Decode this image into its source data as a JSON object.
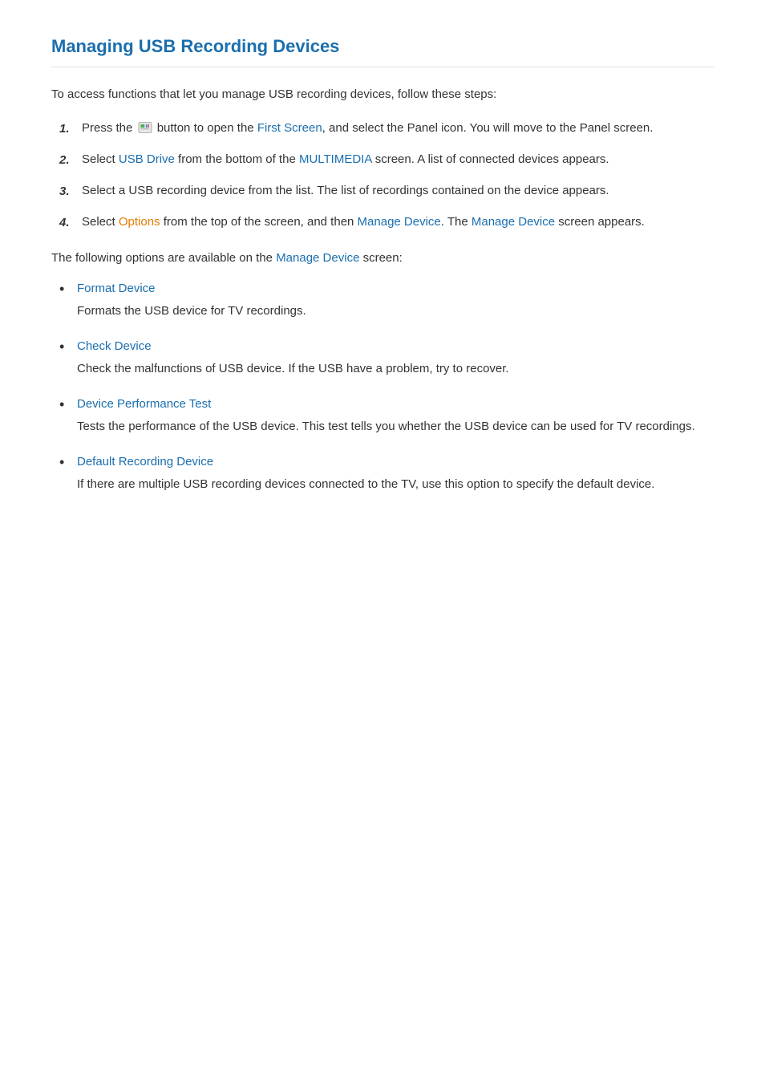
{
  "page": {
    "title": "Managing USB Recording Devices",
    "intro": "To access functions that let you manage USB recording devices, follow these steps:",
    "steps": [
      {
        "number": "1.",
        "text_before": "Press the",
        "icon": "usb-icon",
        "text_after": "button to open the",
        "link1": "First Screen",
        "text_middle": ", and select the Panel icon. You will move to the Panel screen."
      },
      {
        "number": "2.",
        "text_before": "Select",
        "link1": "USB Drive",
        "text_middle": "from the bottom of the",
        "link2": "MULTIMEDIA",
        "text_after": "screen. A list of connected devices appears."
      },
      {
        "number": "3.",
        "text": "Select a USB recording device from the list. The list of recordings contained on the device appears."
      },
      {
        "number": "4.",
        "text_before": "Select",
        "link1": "Options",
        "text_middle": "from the top of the screen, and then",
        "link2": "Manage Device",
        "text_after": ". The",
        "link3": "Manage Device",
        "text_end": "screen appears."
      }
    ],
    "options_intro_before": "The following options are available on the",
    "options_intro_link": "Manage Device",
    "options_intro_after": "screen:",
    "options": [
      {
        "title": "Format Device",
        "description": "Formats the USB device for TV recordings."
      },
      {
        "title": "Check Device",
        "description": "Check the malfunctions of USB device. If the USB have a problem, try to recover."
      },
      {
        "title": "Device Performance Test",
        "description": "Tests the performance of the USB device. This test tells you whether the USB device can be used for TV recordings."
      },
      {
        "title": "Default Recording Device",
        "description": "If there are multiple USB recording devices connected to the TV, use this option to specify the default device."
      }
    ]
  }
}
